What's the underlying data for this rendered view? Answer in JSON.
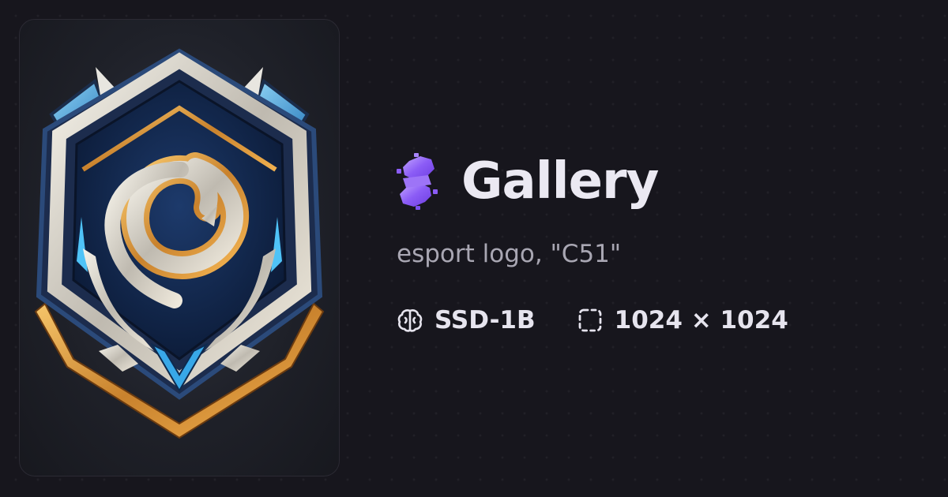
{
  "header": {
    "title": "Gallery",
    "brand_icon": "purple-bolt-logo-icon"
  },
  "image": {
    "description_icon": "esport-badge-image",
    "prompt": "esport logo, \"C51\""
  },
  "meta": {
    "model": {
      "icon": "brain-icon",
      "label": "SSD-1B"
    },
    "dimensions": {
      "icon": "dashed-square-icon",
      "label": "1024 × 1024"
    }
  },
  "colors": {
    "background": "#17161d",
    "title": "#ebe9f2",
    "prompt": "#a9a7b3",
    "accent": "#8b5cf6"
  }
}
